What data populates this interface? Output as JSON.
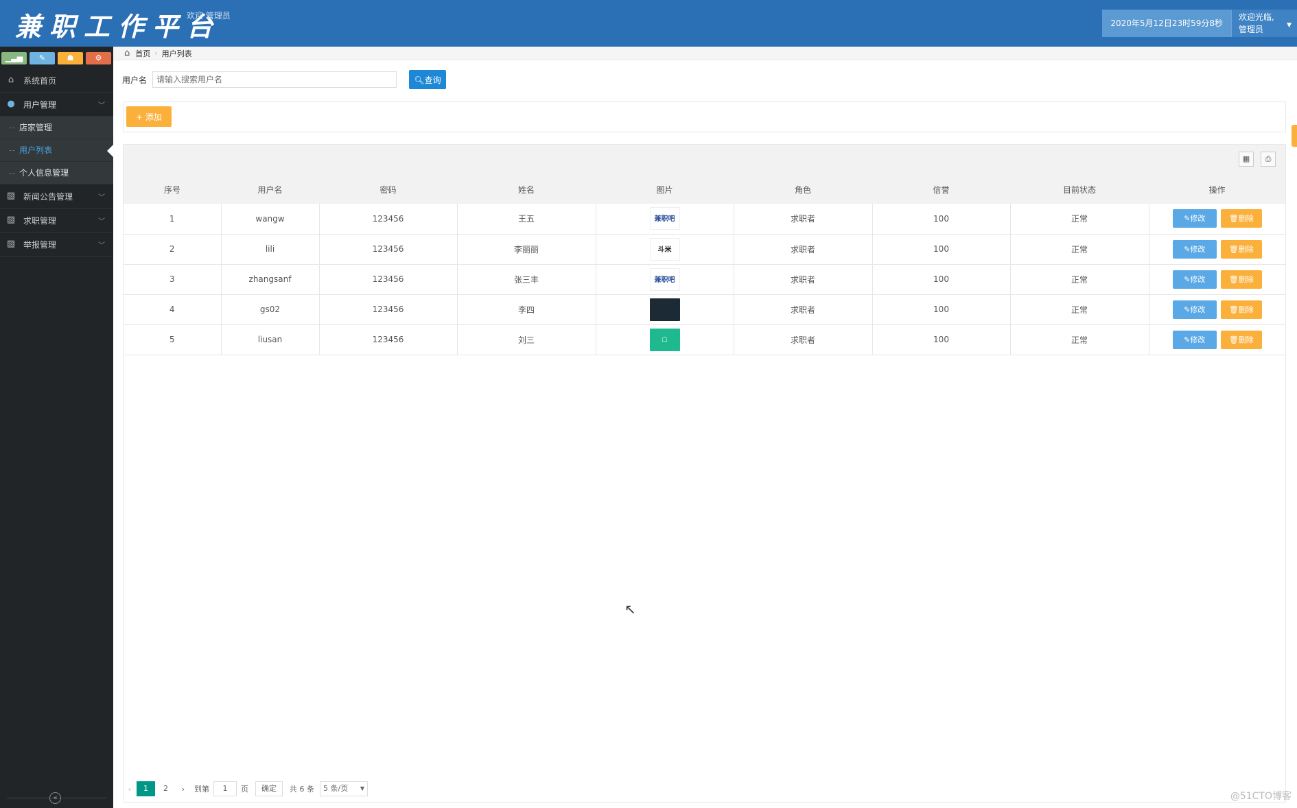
{
  "header": {
    "title": "兼职工作平台",
    "subtitle": "欢迎·管理员",
    "datetime": "2020年5月12日23时59分8秒",
    "welcome_line1": "欢迎光临,",
    "welcome_line2": "管理员"
  },
  "sidebar": {
    "shortcuts": [
      {
        "icon": "chart-icon",
        "color": "#87b87f"
      },
      {
        "icon": "pencil-icon",
        "color": "#6fb3e0"
      },
      {
        "icon": "users-icon",
        "color": "#fbb03b"
      },
      {
        "icon": "settings-icon",
        "color": "#e36e4a"
      }
    ],
    "items": [
      {
        "label": "系统首页",
        "icon": "home-icon"
      },
      {
        "label": "用户管理",
        "icon": "user-icon"
      },
      {
        "label": "新闻公告管理",
        "icon": "picture-icon"
      },
      {
        "label": "求职管理",
        "icon": "picture-icon"
      },
      {
        "label": "举报管理",
        "icon": "picture-icon"
      }
    ],
    "sub_items": [
      {
        "label": "店家管理"
      },
      {
        "label": "用户列表"
      },
      {
        "label": "个人信息管理"
      }
    ]
  },
  "breadcrumb": {
    "home": "首页",
    "current": "用户列表"
  },
  "search": {
    "label": "用户名",
    "placeholder": "请输入搜索用户名",
    "button": "查询"
  },
  "toolbar": {
    "add_label": "+ 添加"
  },
  "table": {
    "columns": [
      "序号",
      "用户名",
      "密码",
      "姓名",
      "图片",
      "角色",
      "信誉",
      "目前状态",
      "操作"
    ],
    "rows": [
      {
        "id": "1",
        "username": "wangw",
        "password": "123456",
        "name": "王五",
        "image": "兼职吧",
        "role": "求职者",
        "credit": "100",
        "status": "正常"
      },
      {
        "id": "2",
        "username": "lili",
        "password": "123456",
        "name": "李丽丽",
        "image": "斗米",
        "role": "求职者",
        "credit": "100",
        "status": "正常"
      },
      {
        "id": "3",
        "username": "zhangsanf",
        "password": "123456",
        "name": "张三丰",
        "image": "兼职吧",
        "role": "求职者",
        "credit": "100",
        "status": "正常"
      },
      {
        "id": "4",
        "username": "gs02",
        "password": "123456",
        "name": "李四",
        "image": "",
        "role": "求职者",
        "credit": "100",
        "status": "正常"
      },
      {
        "id": "5",
        "username": "liusan",
        "password": "123456",
        "name": "刘三",
        "image": "",
        "role": "求职者",
        "credit": "100",
        "status": "正常"
      }
    ],
    "edit_label": "修改",
    "delete_label": "删除"
  },
  "pager": {
    "pages": [
      "1",
      "2"
    ],
    "goto_label": "到第",
    "page_value": "1",
    "page_unit": "页",
    "confirm": "确定",
    "total": "共 6 条",
    "page_size": "5 条/页"
  },
  "watermark": "@51CTO博客",
  "colors": {
    "header": "#2b6fb5",
    "sidebar": "#212527",
    "accent_blue": "#1e88d6",
    "accent_orange": "#fbb03b",
    "pager_active": "#009688"
  }
}
